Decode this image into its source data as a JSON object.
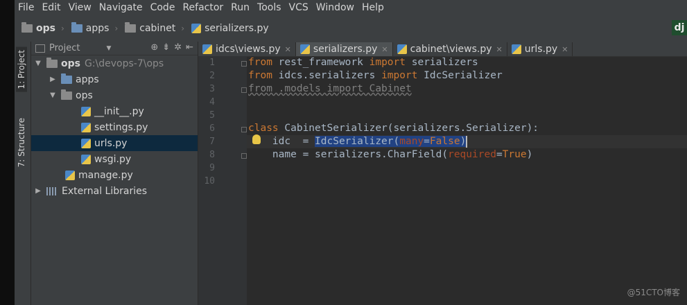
{
  "menu": [
    "File",
    "Edit",
    "View",
    "Navigate",
    "Code",
    "Refactor",
    "Run",
    "Tools",
    "VCS",
    "Window",
    "Help"
  ],
  "breadcrumb": {
    "items": [
      "ops",
      "apps",
      "cabinet",
      "serializers.py"
    ]
  },
  "plugin_badge": "dj",
  "side_tabs": {
    "project": "1: Project",
    "structure": "7: Structure"
  },
  "project_panel": {
    "title": "Project",
    "tree": [
      {
        "label": "ops",
        "path": "G:\\devops-7\\ops",
        "arrow": "▼"
      },
      {
        "label": "apps",
        "arrow": "▶"
      },
      {
        "label": "ops",
        "arrow": "▼"
      },
      {
        "label": "__init__.py"
      },
      {
        "label": "settings.py"
      },
      {
        "label": "urls.py"
      },
      {
        "label": "wsgi.py"
      },
      {
        "label": "manage.py"
      },
      {
        "label": "External Libraries",
        "arrow": "▶"
      }
    ]
  },
  "editor": {
    "tabs": [
      {
        "label": "idcs\\views.py"
      },
      {
        "label": "serializers.py"
      },
      {
        "label": "cabinet\\views.py"
      },
      {
        "label": "urls.py"
      }
    ],
    "line_numbers": [
      "1",
      "2",
      "3",
      "4",
      "5",
      "6",
      "7",
      "8",
      "9",
      "10"
    ],
    "code": {
      "l1": [
        "from",
        " rest_framework ",
        "import",
        " serializers"
      ],
      "l2": [
        "from",
        " idcs.serializers ",
        "import",
        " IdcSerializer"
      ],
      "l3": "from .models import Cabinet",
      "l6": [
        "class",
        " CabinetSerializer(serializers.Serializer):"
      ],
      "l7": [
        "    idc  = ",
        "IdcSerializer(",
        "many",
        "=",
        "False",
        ")"
      ],
      "l8": [
        "    name = serializers.CharField(",
        "required",
        "=",
        "True",
        ")"
      ]
    }
  },
  "watermark": "@51CTO博客",
  "colors": {
    "keyword": "#cc7832",
    "param": "#aa4926",
    "selection": "#214283",
    "text": "#a9b7c6"
  }
}
